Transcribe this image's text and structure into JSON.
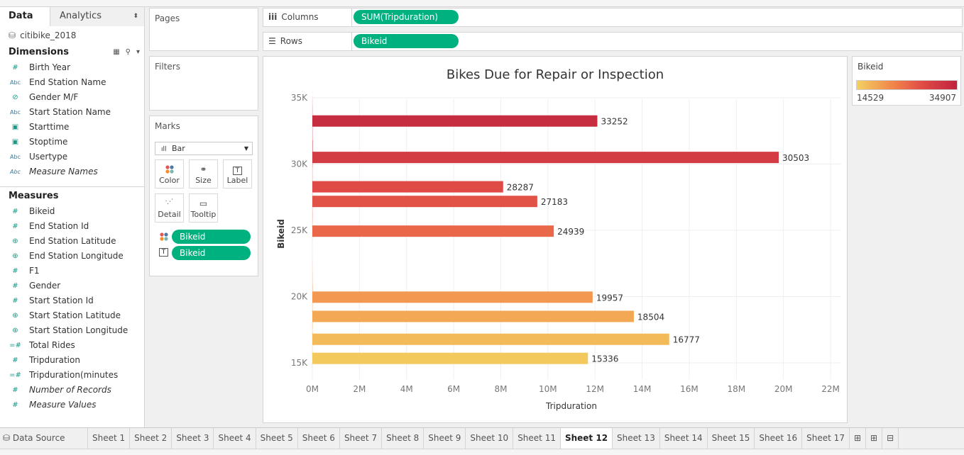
{
  "data_pane": {
    "tab_data": "Data",
    "tab_analytics": "Analytics",
    "datasource": "citibike_2018",
    "dimensions_title": "Dimensions",
    "dimensions": [
      {
        "icon": "#",
        "label": "Birth Year",
        "italic": false
      },
      {
        "icon": "Abc",
        "label": "End Station Name",
        "italic": false
      },
      {
        "icon": "paperclip",
        "label": "Gender M/F",
        "italic": false
      },
      {
        "icon": "Abc",
        "label": "Start Station Name",
        "italic": false
      },
      {
        "icon": "calendar",
        "label": "Starttime",
        "italic": false
      },
      {
        "icon": "calendar",
        "label": "Stoptime",
        "italic": false
      },
      {
        "icon": "Abc",
        "label": "Usertype",
        "italic": false
      },
      {
        "icon": "Abc",
        "label": "Measure Names",
        "italic": true
      }
    ],
    "measures_title": "Measures",
    "measures": [
      {
        "icon": "#",
        "label": "Bikeid",
        "italic": false
      },
      {
        "icon": "#",
        "label": "End Station Id",
        "italic": false
      },
      {
        "icon": "globe",
        "label": "End Station Latitude",
        "italic": false
      },
      {
        "icon": "globe",
        "label": "End Station Longitude",
        "italic": false
      },
      {
        "icon": "#",
        "label": "F1",
        "italic": false
      },
      {
        "icon": "#",
        "label": "Gender",
        "italic": false
      },
      {
        "icon": "#",
        "label": "Start Station Id",
        "italic": false
      },
      {
        "icon": "globe",
        "label": "Start Station Latitude",
        "italic": false
      },
      {
        "icon": "globe",
        "label": "Start Station Longitude",
        "italic": false
      },
      {
        "icon": "=#",
        "label": "Total Rides",
        "italic": false
      },
      {
        "icon": "#",
        "label": "Tripduration",
        "italic": false
      },
      {
        "icon": "=#",
        "label": "Tripduration(minutes",
        "italic": false
      },
      {
        "icon": "#",
        "label": "Number of Records",
        "italic": true
      },
      {
        "icon": "#",
        "label": "Measure Values",
        "italic": true
      }
    ]
  },
  "cards": {
    "pages": "Pages",
    "filters": "Filters",
    "marks": "Marks",
    "mark_type": "Bar",
    "mark_buttons": [
      "Color",
      "Size",
      "Label",
      "Detail",
      "Tooltip"
    ],
    "mark_pills": [
      "Bikeid",
      "Bikeid"
    ]
  },
  "shelves": {
    "columns_label": "Columns",
    "columns_pill": "SUM(Tripduration)",
    "rows_label": "Rows",
    "rows_pill": "Bikeid"
  },
  "legend": {
    "title": "Bikeid",
    "min": "14529",
    "max": "34907",
    "colors": [
      "#f3d260",
      "#f28a4c",
      "#e04a46",
      "#bf233e"
    ]
  },
  "chart_data": {
    "type": "bar",
    "title": "Bikes Due for Repair or Inspection",
    "xlabel": "Tripduration",
    "ylabel": "Bikeid",
    "xlim": [
      0,
      22000000
    ],
    "ylim": [
      13500,
      36500
    ],
    "x_ticks": [
      "0M",
      "2M",
      "4M",
      "6M",
      "8M",
      "10M",
      "12M",
      "14M",
      "16M",
      "18M",
      "20M",
      "22M"
    ],
    "y_ticks": [
      "15K",
      "20K",
      "25K",
      "30K",
      "35K"
    ],
    "color_domain": [
      14529,
      34907
    ],
    "labeled_bars": [
      {
        "bikeid": 33252,
        "label": "33252",
        "value": 12100000
      },
      {
        "bikeid": 30503,
        "label": "30503",
        "value": 19800000
      },
      {
        "bikeid": 28287,
        "label": "28287",
        "value": 8100000
      },
      {
        "bikeid": 27183,
        "label": "27183",
        "value": 9550000
      },
      {
        "bikeid": 24939,
        "label": "24939",
        "value": 10250000
      },
      {
        "bikeid": 19957,
        "label": "19957",
        "value": 11900000
      },
      {
        "bikeid": 18504,
        "label": "18504",
        "value": 13650000
      },
      {
        "bikeid": 16777,
        "label": "16777",
        "value": 15150000
      },
      {
        "bikeid": 15336,
        "label": "15336",
        "value": 11700000
      }
    ],
    "profile": [
      [
        35400,
        0
      ],
      [
        35100,
        1000
      ],
      [
        34800,
        2150
      ],
      [
        34400,
        2550
      ],
      [
        34000,
        4800
      ],
      [
        33600,
        5300
      ],
      [
        33400,
        12100
      ],
      [
        33100,
        12100
      ],
      [
        32900,
        5400
      ],
      [
        32600,
        7500
      ],
      [
        32200,
        7900
      ],
      [
        31800,
        8500
      ],
      [
        31300,
        16150
      ],
      [
        31000,
        16150
      ],
      [
        30850,
        19800
      ],
      [
        30150,
        19800
      ],
      [
        30000,
        12900
      ],
      [
        29800,
        8700
      ],
      [
        29600,
        5300
      ],
      [
        29200,
        4900
      ],
      [
        28900,
        5800
      ],
      [
        28600,
        5300
      ],
      [
        28400,
        8100
      ],
      [
        28150,
        8100
      ],
      [
        27900,
        6000
      ],
      [
        27600,
        5700
      ],
      [
        27400,
        9550
      ],
      [
        27100,
        9550
      ],
      [
        26800,
        6400
      ],
      [
        26400,
        5500
      ],
      [
        26000,
        8300
      ],
      [
        25800,
        8300
      ],
      [
        25600,
        6600
      ],
      [
        25200,
        5000
      ],
      [
        25000,
        10250
      ],
      [
        24700,
        10250
      ],
      [
        24500,
        2100
      ],
      [
        24200,
        1400
      ],
      [
        23900,
        0
      ],
      [
        23000,
        0
      ],
      [
        22900,
        0
      ],
      [
        22700,
        1150
      ],
      [
        22400,
        1650
      ],
      [
        22100,
        3500
      ],
      [
        21800,
        3100
      ],
      [
        21500,
        4800
      ],
      [
        21200,
        6100
      ],
      [
        20900,
        6400
      ],
      [
        20400,
        11900
      ],
      [
        20100,
        11900
      ],
      [
        19700,
        10000
      ],
      [
        19400,
        9200
      ],
      [
        19000,
        7200
      ],
      [
        18700,
        13650
      ],
      [
        18400,
        13650
      ],
      [
        18000,
        10600
      ],
      [
        17600,
        10600
      ],
      [
        17300,
        5500
      ],
      [
        16900,
        15150
      ],
      [
        16600,
        15150
      ],
      [
        16400,
        14200
      ],
      [
        16100,
        4900
      ],
      [
        15900,
        4700
      ],
      [
        15600,
        11700
      ],
      [
        15300,
        11700
      ],
      [
        15000,
        4400
      ],
      [
        14700,
        2600
      ],
      [
        14529,
        1500
      ]
    ]
  },
  "bottom_tabs": [
    "Data Source",
    "Sheet 1",
    "Sheet 2",
    "Sheet 3",
    "Sheet 4",
    "Sheet 5",
    "Sheet 6",
    "Sheet 7",
    "Sheet 8",
    "Sheet 9",
    "Sheet 10",
    "Sheet 11",
    "Sheet 12",
    "Sheet 13",
    "Sheet 14",
    "Sheet 15",
    "Sheet 16",
    "Sheet 17"
  ],
  "active_tab": "Sheet 12"
}
